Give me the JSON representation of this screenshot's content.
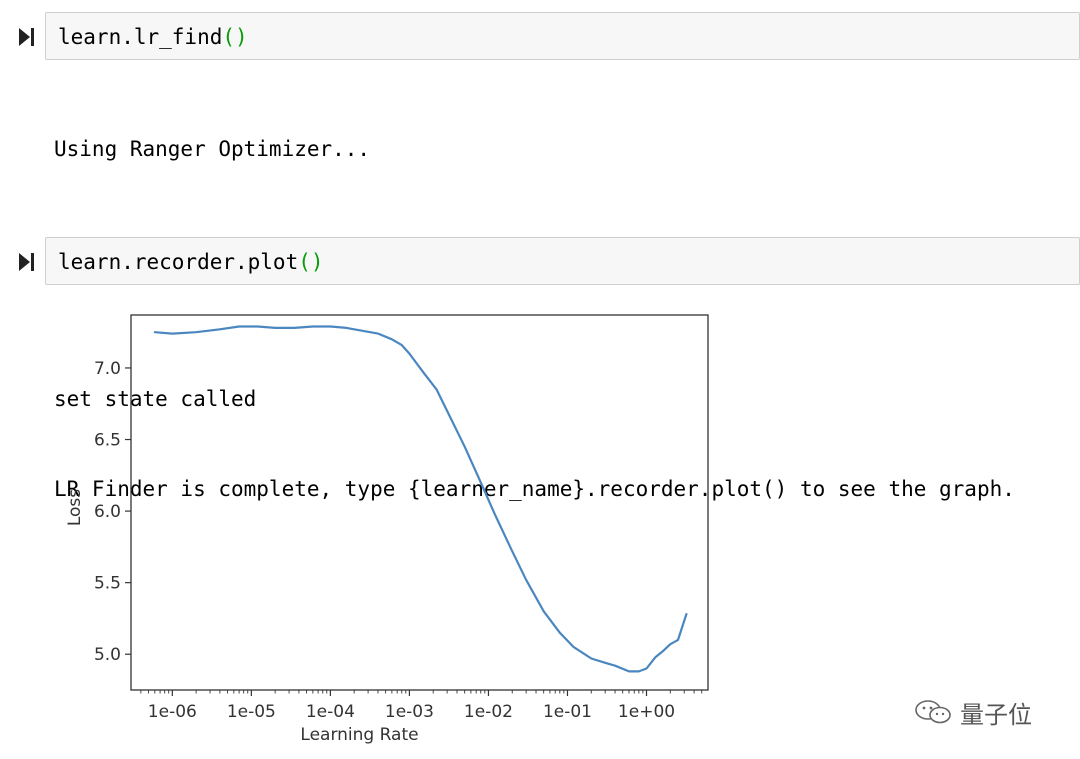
{
  "cells": [
    {
      "code_func": "learn.lr_find",
      "code_parens": "()",
      "output_lines": [
        "Using Ranger Optimizer...",
        "",
        "",
        "set state called",
        "LR Finder is complete, type {learner_name}.recorder.plot() to see the graph."
      ]
    },
    {
      "code_func": "learn.recorder.plot",
      "code_parens": "()"
    }
  ],
  "chart_data": {
    "type": "line",
    "xlabel": "Learning Rate",
    "ylabel": "Loss",
    "x_scale": "log",
    "x_ticks": [
      "1e-06",
      "1e-05",
      "1e-04",
      "1e-03",
      "1e-02",
      "1e-01",
      "1e+00"
    ],
    "y_ticks": [
      "5.0",
      "5.5",
      "6.0",
      "6.5",
      "7.0"
    ],
    "xlim": [
      3e-07,
      6
    ],
    "ylim": [
      4.75,
      7.37
    ],
    "grid": false,
    "series_color": "#4a87c0",
    "x": [
      6e-07,
      1e-06,
      2e-06,
      4e-06,
      7e-06,
      1.2e-05,
      2e-05,
      3.5e-05,
      6e-05,
      0.0001,
      0.00016,
      0.00025,
      0.0004,
      0.0006,
      0.0008,
      0.001,
      0.0015,
      0.0022,
      0.003,
      0.005,
      0.008,
      0.012,
      0.02,
      0.03,
      0.05,
      0.08,
      0.12,
      0.2,
      0.3,
      0.4,
      0.6,
      0.8,
      1.0,
      1.3,
      1.6,
      2.0,
      2.5,
      3.2
    ],
    "y": [
      7.25,
      7.24,
      7.25,
      7.27,
      7.29,
      7.29,
      7.28,
      7.28,
      7.29,
      7.29,
      7.28,
      7.26,
      7.24,
      7.2,
      7.16,
      7.1,
      6.97,
      6.85,
      6.7,
      6.45,
      6.2,
      5.98,
      5.72,
      5.52,
      5.3,
      5.15,
      5.05,
      4.97,
      4.94,
      4.92,
      4.88,
      4.88,
      4.9,
      4.98,
      5.02,
      5.07,
      5.1,
      5.28
    ]
  },
  "watermark": {
    "icon": "wechat-icon",
    "text": "量子位"
  }
}
